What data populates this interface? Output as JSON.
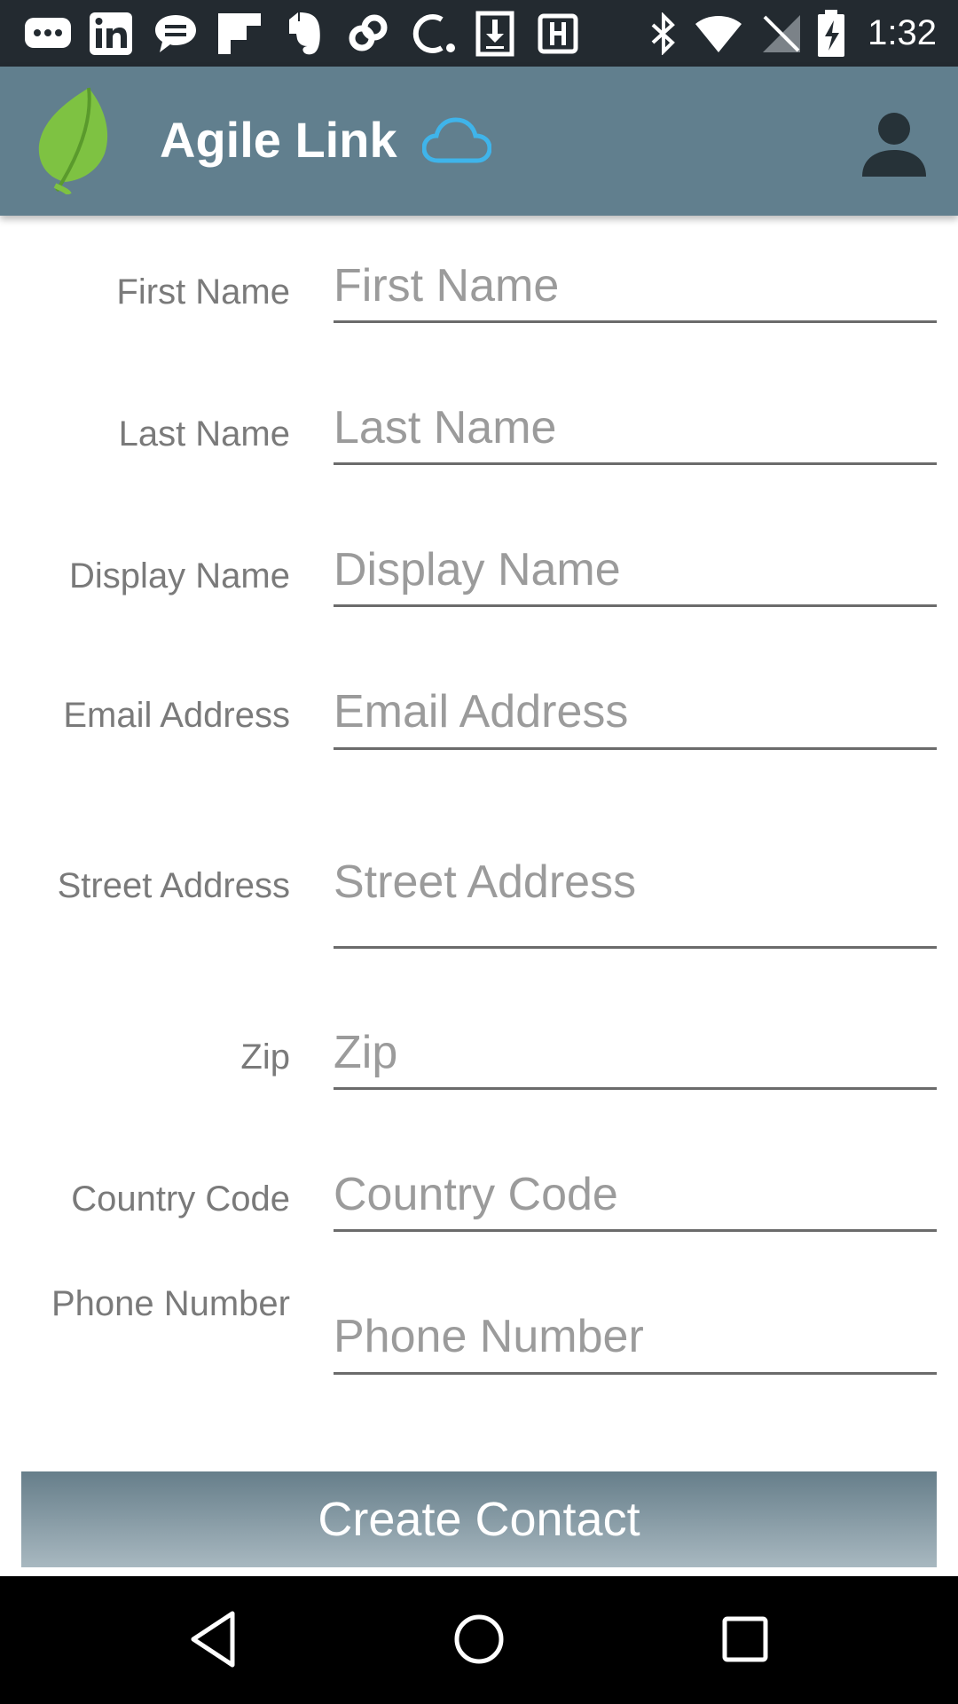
{
  "status_bar": {
    "time": "1:32",
    "notification_icons": [
      "chat-bubble-icon",
      "linkedin-icon",
      "message-icon",
      "flipboard-icon",
      "evernote-icon",
      "link-icon",
      "c-app-icon",
      "download-icon",
      "save-icon"
    ],
    "system_icons": [
      "bluetooth-icon",
      "wifi-icon",
      "no-signal-icon",
      "battery-charging-icon"
    ]
  },
  "app_bar": {
    "title": "Agile Link",
    "logo_icon": "leaf-logo-icon",
    "cloud_icon": "cloud-icon",
    "account_icon": "account-icon",
    "colors": {
      "background": "#617f8e",
      "cloud": "#3fb4ea",
      "logo": "#7ec242"
    }
  },
  "form": {
    "fields": [
      {
        "label": "First Name",
        "placeholder": "First Name",
        "value": ""
      },
      {
        "label": "Last Name",
        "placeholder": "Last Name",
        "value": ""
      },
      {
        "label": "Display Name",
        "placeholder": "Display Name",
        "value": ""
      },
      {
        "label": "Email Address",
        "placeholder": "Email Address",
        "value": ""
      },
      {
        "label": "Street Address",
        "placeholder": "Street Address",
        "value": ""
      },
      {
        "label": "Zip",
        "placeholder": "Zip",
        "value": ""
      },
      {
        "label": "Country Code",
        "placeholder": "Country Code",
        "value": ""
      },
      {
        "label": "Phone Number",
        "placeholder": "Phone Number",
        "value": ""
      }
    ],
    "submit_label": "Create Contact"
  },
  "nav_bar": {
    "back_icon": "back-triangle-icon",
    "home_icon": "home-circle-icon",
    "recents_icon": "recents-square-icon"
  }
}
